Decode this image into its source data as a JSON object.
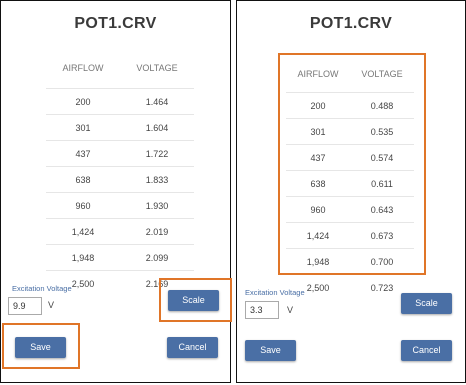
{
  "left": {
    "title": "POT1.CRV",
    "headers": {
      "airflow": "AIRFLOW",
      "voltage": "VOLTAGE"
    },
    "rows": [
      {
        "airflow": "200",
        "voltage": "1.464"
      },
      {
        "airflow": "301",
        "voltage": "1.604"
      },
      {
        "airflow": "437",
        "voltage": "1.722"
      },
      {
        "airflow": "638",
        "voltage": "1.833"
      },
      {
        "airflow": "960",
        "voltage": "1.930"
      },
      {
        "airflow": "1,424",
        "voltage": "2.019"
      },
      {
        "airflow": "1,948",
        "voltage": "2.099"
      },
      {
        "airflow": "2,500",
        "voltage": "2.169"
      }
    ],
    "excitation_label": "Excitation Voltage",
    "excitation_value": "9.9",
    "unit": "V",
    "scale_label": "Scale",
    "save_label": "Save",
    "cancel_label": "Cancel"
  },
  "right": {
    "title": "POT1.CRV",
    "headers": {
      "airflow": "AIRFLOW",
      "voltage": "VOLTAGE"
    },
    "rows": [
      {
        "airflow": "200",
        "voltage": "0.488"
      },
      {
        "airflow": "301",
        "voltage": "0.535"
      },
      {
        "airflow": "437",
        "voltage": "0.574"
      },
      {
        "airflow": "638",
        "voltage": "0.611"
      },
      {
        "airflow": "960",
        "voltage": "0.643"
      },
      {
        "airflow": "1,424",
        "voltage": "0.673"
      },
      {
        "airflow": "1,948",
        "voltage": "0.700"
      },
      {
        "airflow": "2,500",
        "voltage": "0.723"
      }
    ],
    "excitation_label": "Excitation Voltage",
    "excitation_value": "3.3",
    "unit": "V",
    "scale_label": "Scale",
    "save_label": "Save",
    "cancel_label": "Cancel"
  },
  "colors": {
    "accent": "#4a6fa5",
    "highlight": "#e07528"
  }
}
